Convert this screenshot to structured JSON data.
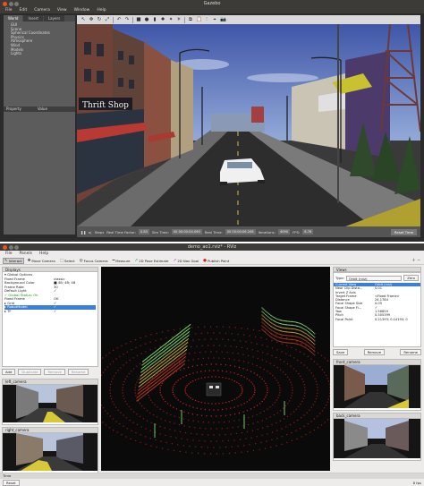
{
  "gazebo": {
    "title": "Gazebo",
    "menu": [
      "File",
      "Edit",
      "Camera",
      "View",
      "Window",
      "Help"
    ],
    "tabs": [
      "World",
      "Insert",
      "Layers"
    ],
    "tree": [
      {
        "label": "GUI",
        "level": "child"
      },
      {
        "label": "Scene",
        "level": "child"
      },
      {
        "label": "Spherical Coordinates",
        "level": "child"
      },
      {
        "label": "Physics",
        "level": "child"
      },
      {
        "label": "Atmosphere",
        "level": "child"
      },
      {
        "label": "Wind",
        "level": "child"
      },
      {
        "label": "Models",
        "level": "child"
      },
      {
        "label": "Lights",
        "level": "child"
      }
    ],
    "property_head": "Property",
    "value_head": "Value",
    "bottom": {
      "steps_label": "Steps",
      "rtf_label": "Real Time Factor:",
      "rtf": "0.83",
      "sim_label": "Sim Time:",
      "sim": "00 00:00:04.090",
      "real_label": "Real Time:",
      "real": "00 00:00:06.208",
      "iter_label": "Iterations:",
      "iter": "4090",
      "fps_label": "FPS:",
      "fps": "6.76",
      "reset": "Reset Time"
    },
    "shop_sign": "Thrift Shop"
  },
  "rviz": {
    "title": "demo_ao1.rviz* - RViz",
    "menu": [
      "File",
      "Panels",
      "Help"
    ],
    "tools": [
      {
        "label": "Interact",
        "icon": "↖",
        "active": true
      },
      {
        "label": "Move Camera",
        "icon": "✥",
        "active": false
      },
      {
        "label": "Select",
        "icon": "⬚",
        "active": false
      },
      {
        "label": "Focus Camera",
        "icon": "◎",
        "active": false
      },
      {
        "label": "Measure",
        "icon": "━",
        "active": false
      },
      {
        "label": "2D Pose Estimate",
        "icon": "➚",
        "active": false
      },
      {
        "label": "2D Nav Goal",
        "icon": "➚",
        "active": false
      },
      {
        "label": "Publish Point",
        "icon": "●",
        "active": false
      }
    ],
    "displays_title": "Displays",
    "displays": [
      {
        "k": "▾ Global Options",
        "v": ""
      },
      {
        "k": "   Fixed Frame",
        "v": "classic"
      },
      {
        "k": "   Background Color",
        "v": "■ 48; 48; 48"
      },
      {
        "k": "   Frame Rate",
        "v": "30"
      },
      {
        "k": "   Default Light",
        "v": "✓"
      },
      {
        "k": "✓ Global Status: Ok",
        "v": ""
      },
      {
        "k": "   Fixed Frame",
        "v": "OK"
      },
      {
        "k": "▸ Grid",
        "v": "✓"
      },
      {
        "k": "▸ RobotModel",
        "v": "✓"
      },
      {
        "k": "▸ TF",
        "v": "✓"
      }
    ],
    "display_buttons": [
      "Add",
      "Duplicate",
      "Remove",
      "Rename"
    ],
    "left_camera": "left_camera",
    "right_camera": "right_camera",
    "views_title": "Views",
    "type_label": "Type:",
    "type_value": "Orbit (rviz)",
    "zero": "Zero",
    "views_head": [
      "Current View",
      "Orbit (rviz)"
    ],
    "views": [
      {
        "k": "Near Clip Dista...",
        "v": "0.01"
      },
      {
        "k": "Invert Z Axis",
        "v": ""
      },
      {
        "k": "Target Frame",
        "v": "<Fixed Frame>"
      },
      {
        "k": "Distance",
        "v": "24.1784"
      },
      {
        "k": "Focal Shape Size",
        "v": "0.05"
      },
      {
        "k": "Focal Shape Fi...",
        "v": "✓"
      },
      {
        "k": "Yaw",
        "v": "1.56859"
      },
      {
        "k": "Pitch",
        "v": "0.505399"
      },
      {
        "k": "Focal Point",
        "v": "0.21393; 0.14193; 0"
      }
    ],
    "view_buttons": [
      "Save",
      "Remove",
      "Rename"
    ],
    "front_camera": "front_camera",
    "back_camera": "back_camera",
    "time": {
      "title": "Time",
      "ros_time_label": "ROS Time:",
      "ros_time": "4.16",
      "ros_elapsed_label": "ROS Elapsed:",
      "ros_elapsed": "4.15",
      "wall_time_label": "Wall Time:",
      "wall_time": "1557597178.47",
      "wall_elapsed_label": "Wall Elapsed:",
      "wall_elapsed": "143.90",
      "experimental": "Experimental",
      "fps": "8 fps",
      "reset": "Reset"
    }
  }
}
